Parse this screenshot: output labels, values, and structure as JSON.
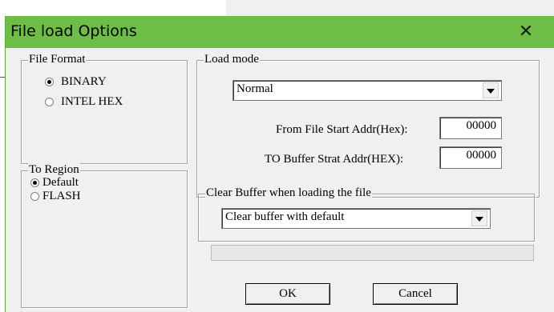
{
  "window": {
    "title": "File load Options"
  },
  "file_format": {
    "label": "File Format",
    "options": [
      {
        "label": "BINARY",
        "selected": true
      },
      {
        "label": "INTEL HEX",
        "selected": false
      }
    ]
  },
  "to_region": {
    "label": "To Region",
    "options": [
      {
        "label": "Default",
        "selected": true
      },
      {
        "label": "FLASH",
        "selected": false
      }
    ]
  },
  "load_mode": {
    "label": "Load mode",
    "selected": "Normal",
    "from_label": "From File Start Addr(Hex):",
    "from_value": "00000",
    "to_label": "TO Buffer Strat Addr(HEX):",
    "to_value": "00000"
  },
  "clear_buffer": {
    "label": "Clear Buffer when loading the file",
    "selected": "Clear buffer with default"
  },
  "buttons": {
    "ok": "OK",
    "cancel": "Cancel"
  },
  "icons": {
    "close": "close-icon"
  }
}
